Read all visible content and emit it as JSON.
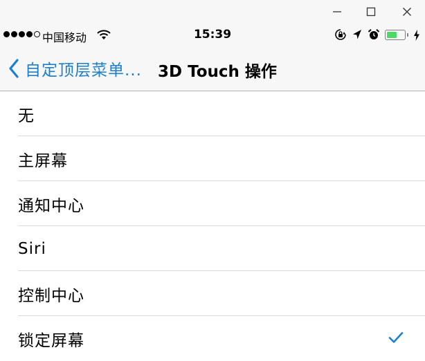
{
  "window_controls": {
    "minimize_icon": "minimize-icon",
    "maximize_icon": "maximize-icon",
    "close_icon": "close-icon"
  },
  "status_bar": {
    "signal_bars_filled": 4,
    "signal_bars_total": 5,
    "carrier": "中国移动",
    "time": "15:39",
    "battery_level": 0.6,
    "icons": [
      "wifi-icon",
      "rotation-lock-icon",
      "location-arrow-icon",
      "alarm-icon",
      "battery-icon",
      "charging-bolt-icon"
    ]
  },
  "nav": {
    "back_label": "自定顶层菜单...",
    "title": "3D Touch 操作",
    "back_icon": "chevron-left-icon"
  },
  "options": [
    {
      "label": "无",
      "selected": false
    },
    {
      "label": "主屏幕",
      "selected": false
    },
    {
      "label": "通知中心",
      "selected": false
    },
    {
      "label": "Siri",
      "selected": false
    },
    {
      "label": "控制中心",
      "selected": false
    },
    {
      "label": "锁定屏幕",
      "selected": true
    }
  ],
  "colors": {
    "accent": "#1a7fd0",
    "battery_fill": "#4cd964",
    "bar_background": "#f7f7f7",
    "separator": "#d9d9dd"
  }
}
